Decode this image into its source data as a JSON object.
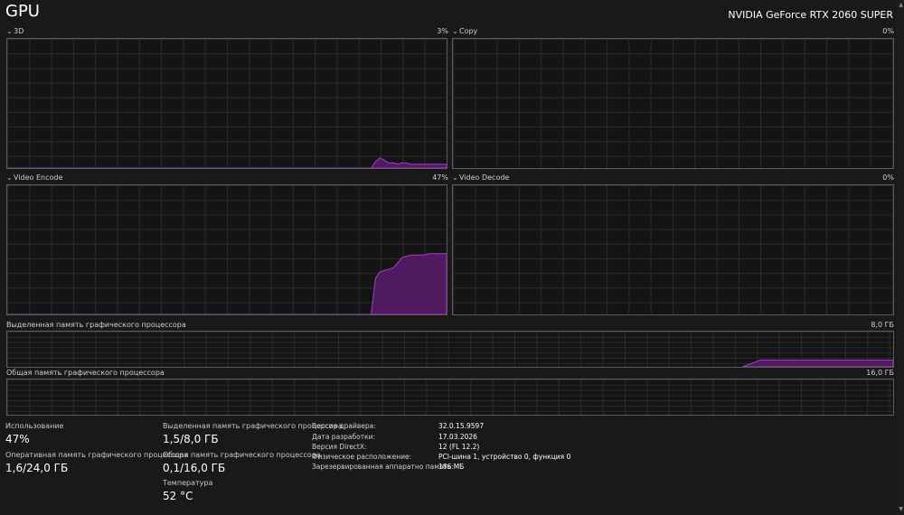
{
  "header": {
    "title": "GPU",
    "gpu_name": "NVIDIA GeForce RTX 2060 SUPER"
  },
  "graphs": {
    "g3d": {
      "label": "3D",
      "value": "3%",
      "utilization": [
        0,
        0,
        0,
        0,
        0,
        0,
        0,
        0,
        0,
        0,
        0,
        0,
        0,
        0,
        0,
        0,
        0,
        0,
        0,
        0,
        0,
        0,
        0,
        0,
        0,
        0,
        0,
        0,
        0,
        0,
        0,
        0,
        0,
        0,
        0,
        0,
        0,
        0,
        0,
        0,
        0,
        0,
        0,
        0,
        0,
        0,
        0,
        0,
        0,
        0,
        0,
        0,
        0,
        0,
        0,
        0,
        0,
        0,
        0,
        0,
        0,
        0,
        0,
        0,
        0,
        0,
        0,
        0,
        0,
        0,
        0,
        0,
        0,
        0,
        0,
        0,
        0,
        0,
        0,
        0,
        0,
        0,
        0,
        5,
        8,
        6,
        4,
        4,
        3,
        4,
        4,
        3,
        3,
        3,
        3,
        3,
        3,
        3,
        3,
        3
      ]
    },
    "copy": {
      "label": "Copy",
      "value": "0%"
    },
    "video_encode": {
      "label": "Video Encode",
      "value": "47%",
      "utilization": [
        0,
        0,
        0,
        0,
        0,
        0,
        0,
        0,
        0,
        0,
        0,
        0,
        0,
        0,
        0,
        0,
        0,
        0,
        0,
        0,
        0,
        0,
        0,
        0,
        0,
        0,
        0,
        0,
        0,
        0,
        0,
        0,
        0,
        0,
        0,
        0,
        0,
        0,
        0,
        0,
        0,
        0,
        0,
        0,
        0,
        0,
        0,
        0,
        0,
        0,
        0,
        0,
        0,
        0,
        0,
        0,
        0,
        0,
        0,
        0,
        0,
        0,
        0,
        0,
        0,
        0,
        0,
        0,
        0,
        0,
        0,
        0,
        0,
        0,
        0,
        0,
        0,
        0,
        0,
        0,
        0,
        0,
        0,
        28,
        33,
        34,
        35,
        36,
        40,
        44,
        45,
        46,
        46,
        46,
        46,
        47,
        47,
        47,
        47,
        47
      ]
    },
    "video_decode": {
      "label": "Video Decode",
      "value": "0%"
    },
    "dedicated_memory": {
      "label": "Выделенная память графического процессора",
      "value": "8,0 ГБ",
      "usage_fraction": [
        [
          0.83,
          0
        ],
        [
          0.85,
          0.19
        ],
        [
          1,
          0.19
        ]
      ]
    },
    "shared_memory": {
      "label": "Общая память графического процессора",
      "value": "16,0 ГБ"
    }
  },
  "stats": {
    "utilization_label": "Использование",
    "utilization_value": "47%",
    "ram_label": "Оперативная память графического процессора",
    "ram_value": "1,6/24,0 ГБ",
    "dedicated_label": "Выделенная память графического процессора",
    "dedicated_value": "1,5/8,0 ГБ",
    "shared_label": "Общая память графического процессора",
    "shared_value": "0,1/16,0 ГБ",
    "temp_label": "Температура",
    "temp_value": "52 °C"
  },
  "info": {
    "driver_version_label": "Версия драйвера:",
    "driver_version_value": "32.0.15.9597",
    "driver_date_label": "Дата разработки:",
    "driver_date_value": "17.03.2026",
    "directx_label": "Версия DirectX:",
    "directx_value": "12 (FL 12.2)",
    "location_label": "Физическое расположение:",
    "location_value": "PCI-шина 1, устройство 0, функция 0",
    "reserved_label": "Зарезервированная аппаратно память:",
    "reserved_value": "186 МБ"
  },
  "colors": {
    "accent_line": "#a43fc8",
    "accent_fill": "#4f1a5f"
  },
  "icons": {
    "chevron": "chevron-down-icon"
  }
}
